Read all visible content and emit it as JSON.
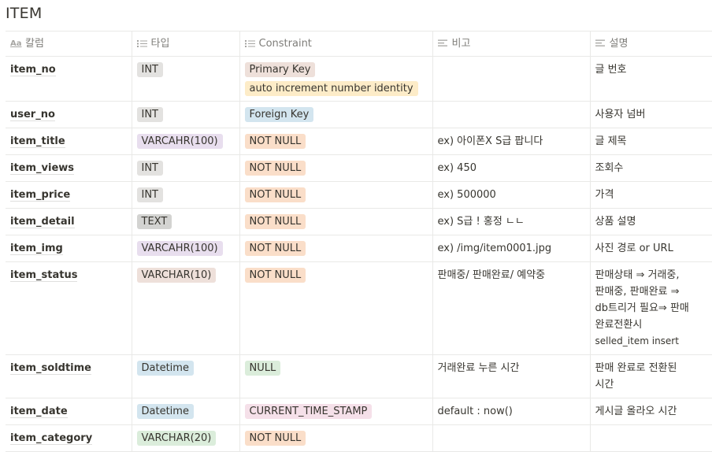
{
  "title": "ITEM",
  "colors": {
    "gray": "#e3e2e0",
    "gray_dark": "#d3d3d1",
    "brown": "#eee0da",
    "orange": "#fadec9",
    "yellow": "#fdecc8",
    "blue": "#d3e5ef",
    "purple": "#e8deee",
    "pink": "#f5e0e9",
    "green": "#dbeddb"
  },
  "headers": {
    "column": "칼럼",
    "type": "타입",
    "constraint": "Constraint",
    "remark": "비고",
    "description": "설명"
  },
  "header_icons": {
    "column": "title-aa-icon",
    "type": "list-icon",
    "constraint": "list-icon",
    "remark": "text-lines-icon",
    "description": "text-lines-icon"
  },
  "rows": [
    {
      "name": "item_no",
      "type": {
        "label": "INT",
        "color": "gray"
      },
      "constraints": [
        {
          "label": "Primary Key",
          "color": "brown"
        },
        {
          "label": "auto increment number identity",
          "color": "yellow"
        }
      ],
      "remark": "",
      "description": "글 번호"
    },
    {
      "name": "user_no",
      "type": {
        "label": "INT",
        "color": "gray"
      },
      "constraints": [
        {
          "label": "Foreign Key",
          "color": "blue"
        }
      ],
      "remark": "",
      "description": "사용자 넘버"
    },
    {
      "name": "item_title",
      "type": {
        "label": "VARCAHR(100)",
        "color": "purple"
      },
      "constraints": [
        {
          "label": "NOT NULL",
          "color": "orange"
        }
      ],
      "remark": "ex) 아이폰X S급 팝니다",
      "description": "글 제목"
    },
    {
      "name": "item_views",
      "type": {
        "label": "INT",
        "color": "gray"
      },
      "constraints": [
        {
          "label": "NOT NULL",
          "color": "orange"
        }
      ],
      "remark": "ex) 450",
      "description": "조회수"
    },
    {
      "name": "item_price",
      "type": {
        "label": "INT",
        "color": "gray"
      },
      "constraints": [
        {
          "label": "NOT NULL",
          "color": "orange"
        }
      ],
      "remark": "ex) 500000",
      "description": "가격"
    },
    {
      "name": "item_detail",
      "type": {
        "label": "TEXT",
        "color": "gray_dark"
      },
      "constraints": [
        {
          "label": "NOT NULL",
          "color": "orange"
        }
      ],
      "remark": "ex) S급 ! 홍정 ㄴㄴ",
      "description": "상품 설명"
    },
    {
      "name": "item_img",
      "type": {
        "label": "VARCAHR(100)",
        "color": "purple"
      },
      "constraints": [
        {
          "label": "NOT NULL",
          "color": "orange"
        }
      ],
      "remark": "ex) /img/item0001.jpg",
      "description": "사진 경로 or URL"
    },
    {
      "name": "item_status",
      "type": {
        "label": "VARCHAR(10)",
        "color": "brown"
      },
      "constraints": [
        {
          "label": "NOT NULL",
          "color": "orange"
        }
      ],
      "remark": "판매중/ 판매완료/ 예약중",
      "description_lines": [
        "판매상태 ⇒ 거래중,",
        "판매중, 판매완료 ⇒",
        "db트리거 필요⇒ 판매",
        "완료전환시"
      ],
      "description_small": "selled_item insert"
    },
    {
      "name": "item_soldtime",
      "type": {
        "label": "Datetime",
        "color": "blue"
      },
      "constraints": [
        {
          "label": "NULL",
          "color": "green"
        }
      ],
      "remark": "거래완료 누른 시간",
      "description_lines": [
        "판매 완료로 전환된",
        "시간"
      ]
    },
    {
      "name": "item_date",
      "type": {
        "label": "Datetime",
        "color": "blue"
      },
      "constraints": [
        {
          "label": "CURRENT_TIME_STAMP",
          "color": "pink"
        }
      ],
      "remark": "default : now()",
      "description": "게시글 올라오 시간"
    },
    {
      "name": "item_category",
      "type": {
        "label": "VARCHAR(20)",
        "color": "green"
      },
      "constraints": [
        {
          "label": "NOT NULL",
          "color": "orange"
        }
      ],
      "remark": "",
      "description": ""
    }
  ]
}
